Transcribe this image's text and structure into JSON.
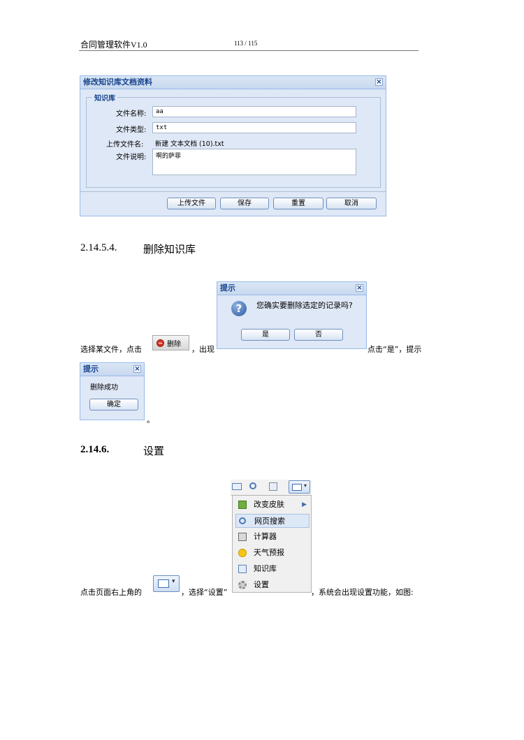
{
  "header": {
    "title": "合同管理软件V1.0",
    "page": "113 / 115"
  },
  "edit_dialog": {
    "title": "修改知识库文档资料",
    "legend": "知识库",
    "fields": [
      {
        "label": "文件名称:",
        "value": "aa"
      },
      {
        "label": "文件类型:",
        "value": "txt"
      },
      {
        "label": "上传文件名:",
        "value": "新建 文本文档 (10).txt"
      },
      {
        "label": "文件说明:",
        "value": "啊的萨菲"
      }
    ],
    "buttons": {
      "upload": "上传文件",
      "save": "保存",
      "reset": "重置",
      "cancel": "取消"
    }
  },
  "section1": {
    "number": "2.14.5.4.",
    "title": "删除知识库"
  },
  "confirm_dialog": {
    "title": "提示",
    "message": "您确实要删除选定的记录吗?",
    "yes": "是",
    "no": "否"
  },
  "delete_para": {
    "before_button": "选择某文件，点击",
    "delete_button": "删除",
    "after_button": "，出现",
    "after_dialog": "点击“是”，提示"
  },
  "success_dialog": {
    "title": "提示",
    "message": "删除成功",
    "ok": "确定",
    "tail": "。"
  },
  "section2": {
    "number": "2.14.6.",
    "title": "设置"
  },
  "settings_menu": {
    "items": [
      "改变皮肤",
      "网页搜索",
      "计算器",
      "天气预报",
      "知识库",
      "设置"
    ]
  },
  "settings_para": {
    "before_icon": "点击页面右上角的",
    "after_icon": "，选择“设置”",
    "after_menu": "，系统会出现设置功能，如图:"
  }
}
